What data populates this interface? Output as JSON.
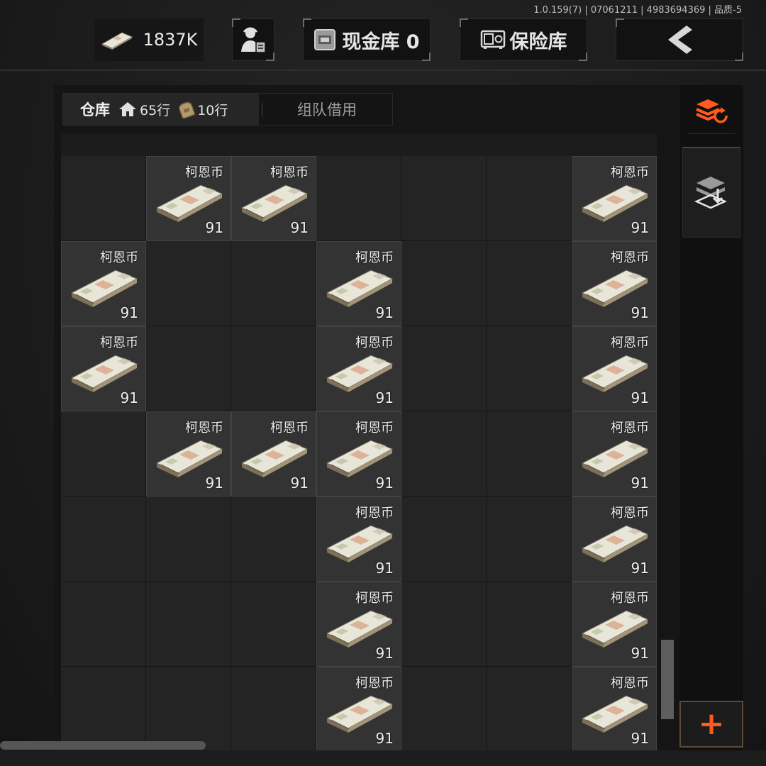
{
  "version": "1.0.159(7) | 07061211 | 4983694369 | 品质-5",
  "topbar": {
    "money": "1837K",
    "cash_vault": "现金库 0",
    "safe": "保险库"
  },
  "tabs": {
    "warehouse": "仓库",
    "home_rows": "65行",
    "bag_rows": "10行",
    "team_borrow": "组队借用"
  },
  "item": {
    "name": "柯恩币",
    "count": "91"
  },
  "grid": {
    "columns": 7,
    "rows": [
      [
        false,
        true,
        true,
        false,
        false,
        false,
        true
      ],
      [
        true,
        false,
        false,
        true,
        false,
        false,
        true
      ],
      [
        true,
        false,
        false,
        true,
        false,
        false,
        true
      ],
      [
        false,
        true,
        true,
        true,
        false,
        false,
        true
      ],
      [
        false,
        false,
        false,
        true,
        false,
        false,
        true
      ],
      [
        false,
        false,
        false,
        true,
        false,
        false,
        true
      ],
      [
        false,
        false,
        false,
        true,
        false,
        false,
        true
      ]
    ]
  },
  "colors": {
    "accent": "#ff5a1f"
  },
  "icons": {
    "money": "cash-stack-icon",
    "agent": "trader-icon",
    "cash_vault": "cash-box-icon",
    "safe": "safe-icon",
    "back": "chevron-left-icon",
    "sort": "sort-stack-icon",
    "store": "layers-download-icon",
    "add": "plus-icon"
  }
}
